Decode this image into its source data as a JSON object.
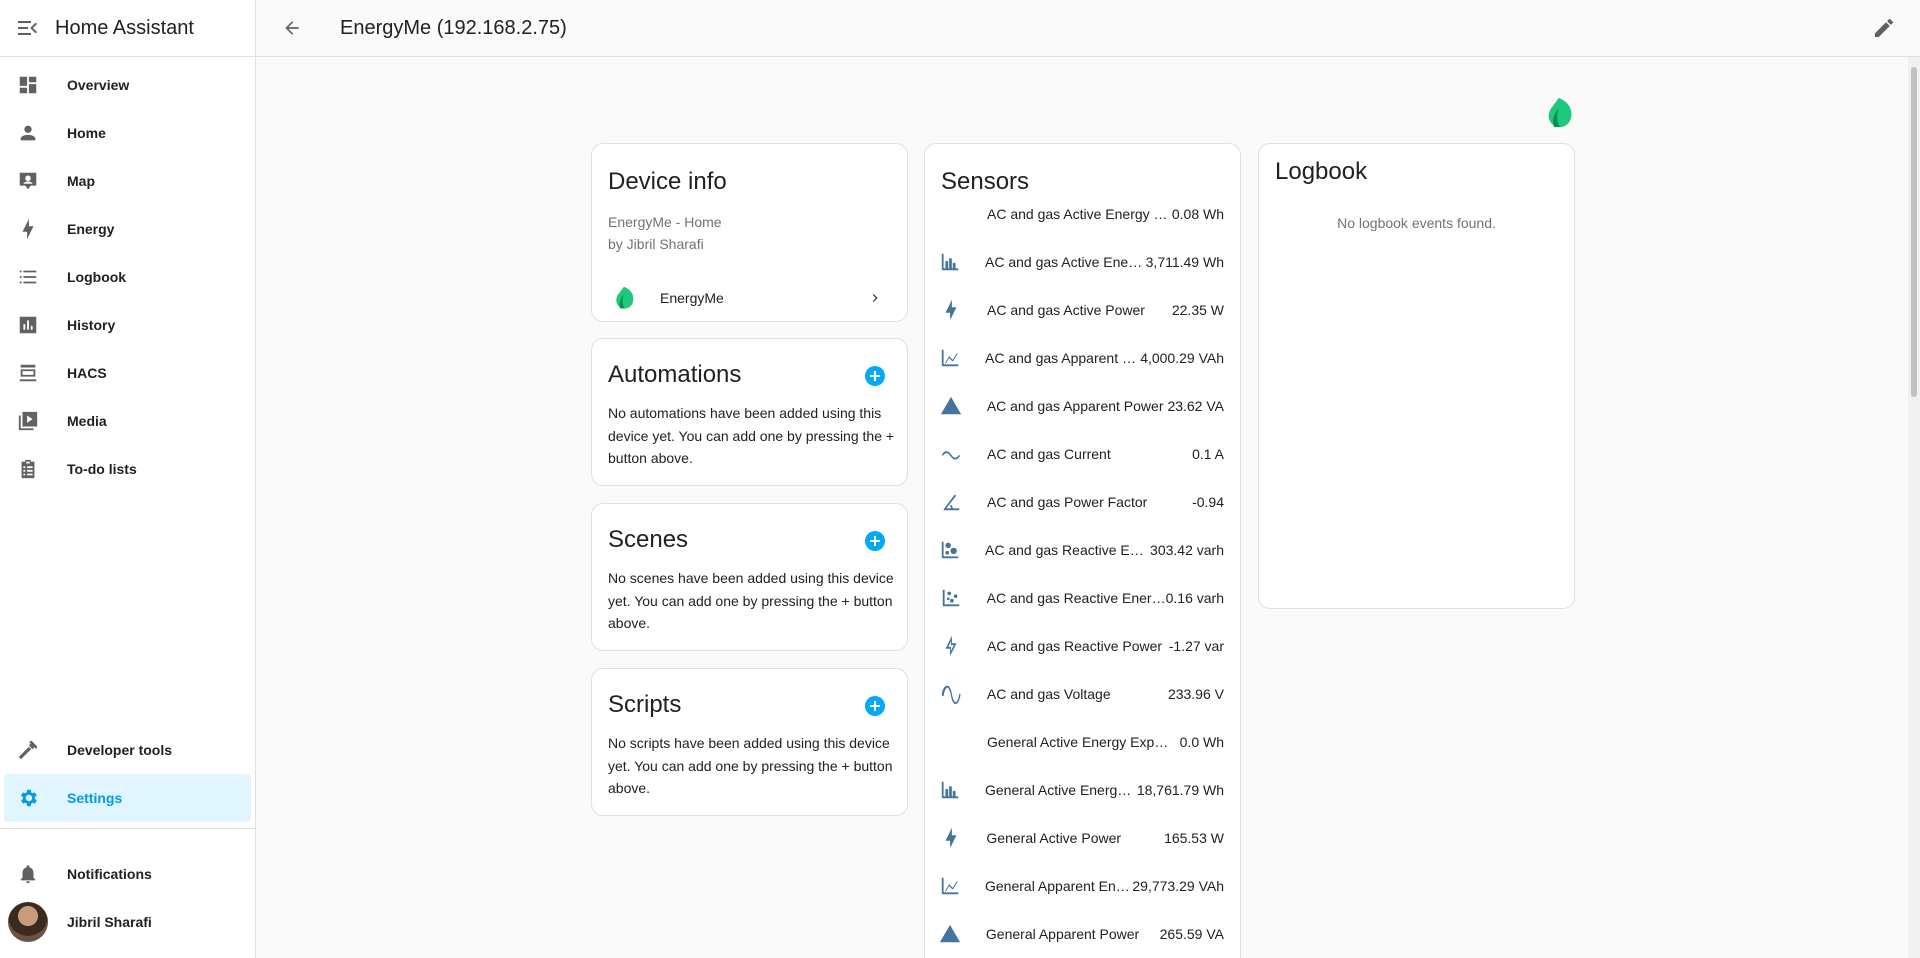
{
  "app": {
    "title": "Home Assistant"
  },
  "sidebar": {
    "items": [
      {
        "label": "Overview",
        "icon": "overview-icon"
      },
      {
        "label": "Home",
        "icon": "person-icon"
      },
      {
        "label": "Map",
        "icon": "map-icon"
      },
      {
        "label": "Energy",
        "icon": "lightning-icon"
      },
      {
        "label": "Logbook",
        "icon": "list-icon"
      },
      {
        "label": "History",
        "icon": "chart-icon"
      },
      {
        "label": "HACS",
        "icon": "hacs-icon"
      },
      {
        "label": "Media",
        "icon": "media-icon"
      },
      {
        "label": "To-do lists",
        "icon": "clipboard-icon"
      }
    ],
    "bottom_items": [
      {
        "label": "Developer tools",
        "icon": "hammer-icon"
      },
      {
        "label": "Settings",
        "icon": "gear-icon",
        "active": true
      }
    ],
    "footer": {
      "notifications": "Notifications",
      "user": "Jibril Sharafi"
    },
    "accent_color": "#039be5"
  },
  "topbar": {
    "title": "EnergyMe (192.168.2.75)"
  },
  "device_info": {
    "title": "Device info",
    "line1": "EnergyMe - Home",
    "line2": "by Jibril Sharafi",
    "integration": "EnergyMe"
  },
  "automations": {
    "title": "Automations",
    "text": "No automations have been added using this device yet. You can add one by pressing the + button above."
  },
  "scenes": {
    "title": "Scenes",
    "text": "No scenes have been added using this device yet. You can add one by pressing the + button above."
  },
  "scripts": {
    "title": "Scripts",
    "text": "No scripts have been added using this device yet. You can add one by pressing the + button above."
  },
  "sensors": {
    "title": "Sensors",
    "rows": [
      {
        "name": "AC and gas Active Energy Export",
        "value": "0.08 Wh",
        "icon": "none"
      },
      {
        "name": "AC and gas Active Energy Import",
        "value": "3,711.49 Wh",
        "icon": "energy-steps-icon"
      },
      {
        "name": "AC and gas Active Power",
        "value": "22.35 W",
        "icon": "lightning-icon"
      },
      {
        "name": "AC and gas Apparent Energy",
        "value": "4,000.29 VAh",
        "icon": "area-chart-icon"
      },
      {
        "name": "AC and gas Apparent Power",
        "value": "23.62 VA",
        "icon": "warning-flash-icon"
      },
      {
        "name": "AC and gas Current",
        "value": "0.1 A",
        "icon": "current-ac-icon"
      },
      {
        "name": "AC and gas Power Factor",
        "value": "-0.94",
        "icon": "angle-icon"
      },
      {
        "name": "AC and gas Reactive Energy Export",
        "value": "303.42 varh",
        "icon": "bubble-chart-icon"
      },
      {
        "name": "AC and gas Reactive Energy Import",
        "value": "0.16 varh",
        "icon": "scatter-chart-icon"
      },
      {
        "name": "AC and gas Reactive Power",
        "value": "-1.27 var",
        "icon": "flash-outline-icon"
      },
      {
        "name": "AC and gas Voltage",
        "value": "233.96 V",
        "icon": "sine-wave-icon"
      },
      {
        "name": "General Active Energy Export",
        "value": "0.0 Wh",
        "icon": "none"
      },
      {
        "name": "General Active Energy Import",
        "value": "18,761.79 Wh",
        "icon": "energy-steps-icon"
      },
      {
        "name": "General Active Power",
        "value": "165.53 W",
        "icon": "lightning-icon"
      },
      {
        "name": "General Apparent Energy",
        "value": "29,773.29 VAh",
        "icon": "area-chart-icon"
      },
      {
        "name": "General Apparent Power",
        "value": "265.59 VA",
        "icon": "warning-flash-icon"
      }
    ]
  },
  "logbook": {
    "title": "Logbook",
    "empty_text": "No logbook events found."
  },
  "brand_logo": "leaf-logo-icon"
}
